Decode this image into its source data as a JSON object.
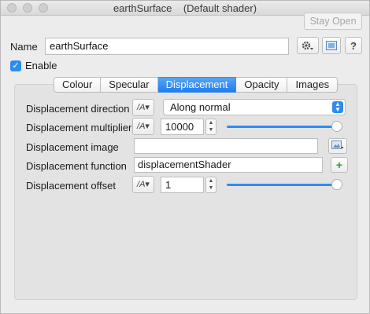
{
  "window": {
    "title": "earthSurface    (Default shader)"
  },
  "toolbar": {
    "stay_open_label": "Stay Open"
  },
  "header": {
    "name_label": "Name",
    "name_value": "earthSurface",
    "enable_label": "Enable",
    "enable_checked": true,
    "icons": [
      "gear-icon",
      "preview-icon",
      "help-icon"
    ],
    "help_label": "?"
  },
  "tabs": [
    {
      "label": "Colour",
      "active": false
    },
    {
      "label": "Specular",
      "active": false
    },
    {
      "label": "Displacement",
      "active": true
    },
    {
      "label": "Opacity",
      "active": false
    },
    {
      "label": "Images",
      "active": false
    }
  ],
  "displacement": {
    "direction": {
      "label": "Displacement direction",
      "value": "Along normal"
    },
    "multiplier": {
      "label": "Displacement multiplier",
      "value": "10000",
      "slider_fraction": 1.0
    },
    "image": {
      "label": "Displacement image",
      "value": ""
    },
    "function": {
      "label": "Displacement function",
      "value": "displacementShader"
    },
    "offset": {
      "label": "Displacement offset",
      "value": "1",
      "slider_fraction": 1.0
    }
  },
  "colors": {
    "accent": "#2d8cf0",
    "add": "#2a9d2a"
  }
}
